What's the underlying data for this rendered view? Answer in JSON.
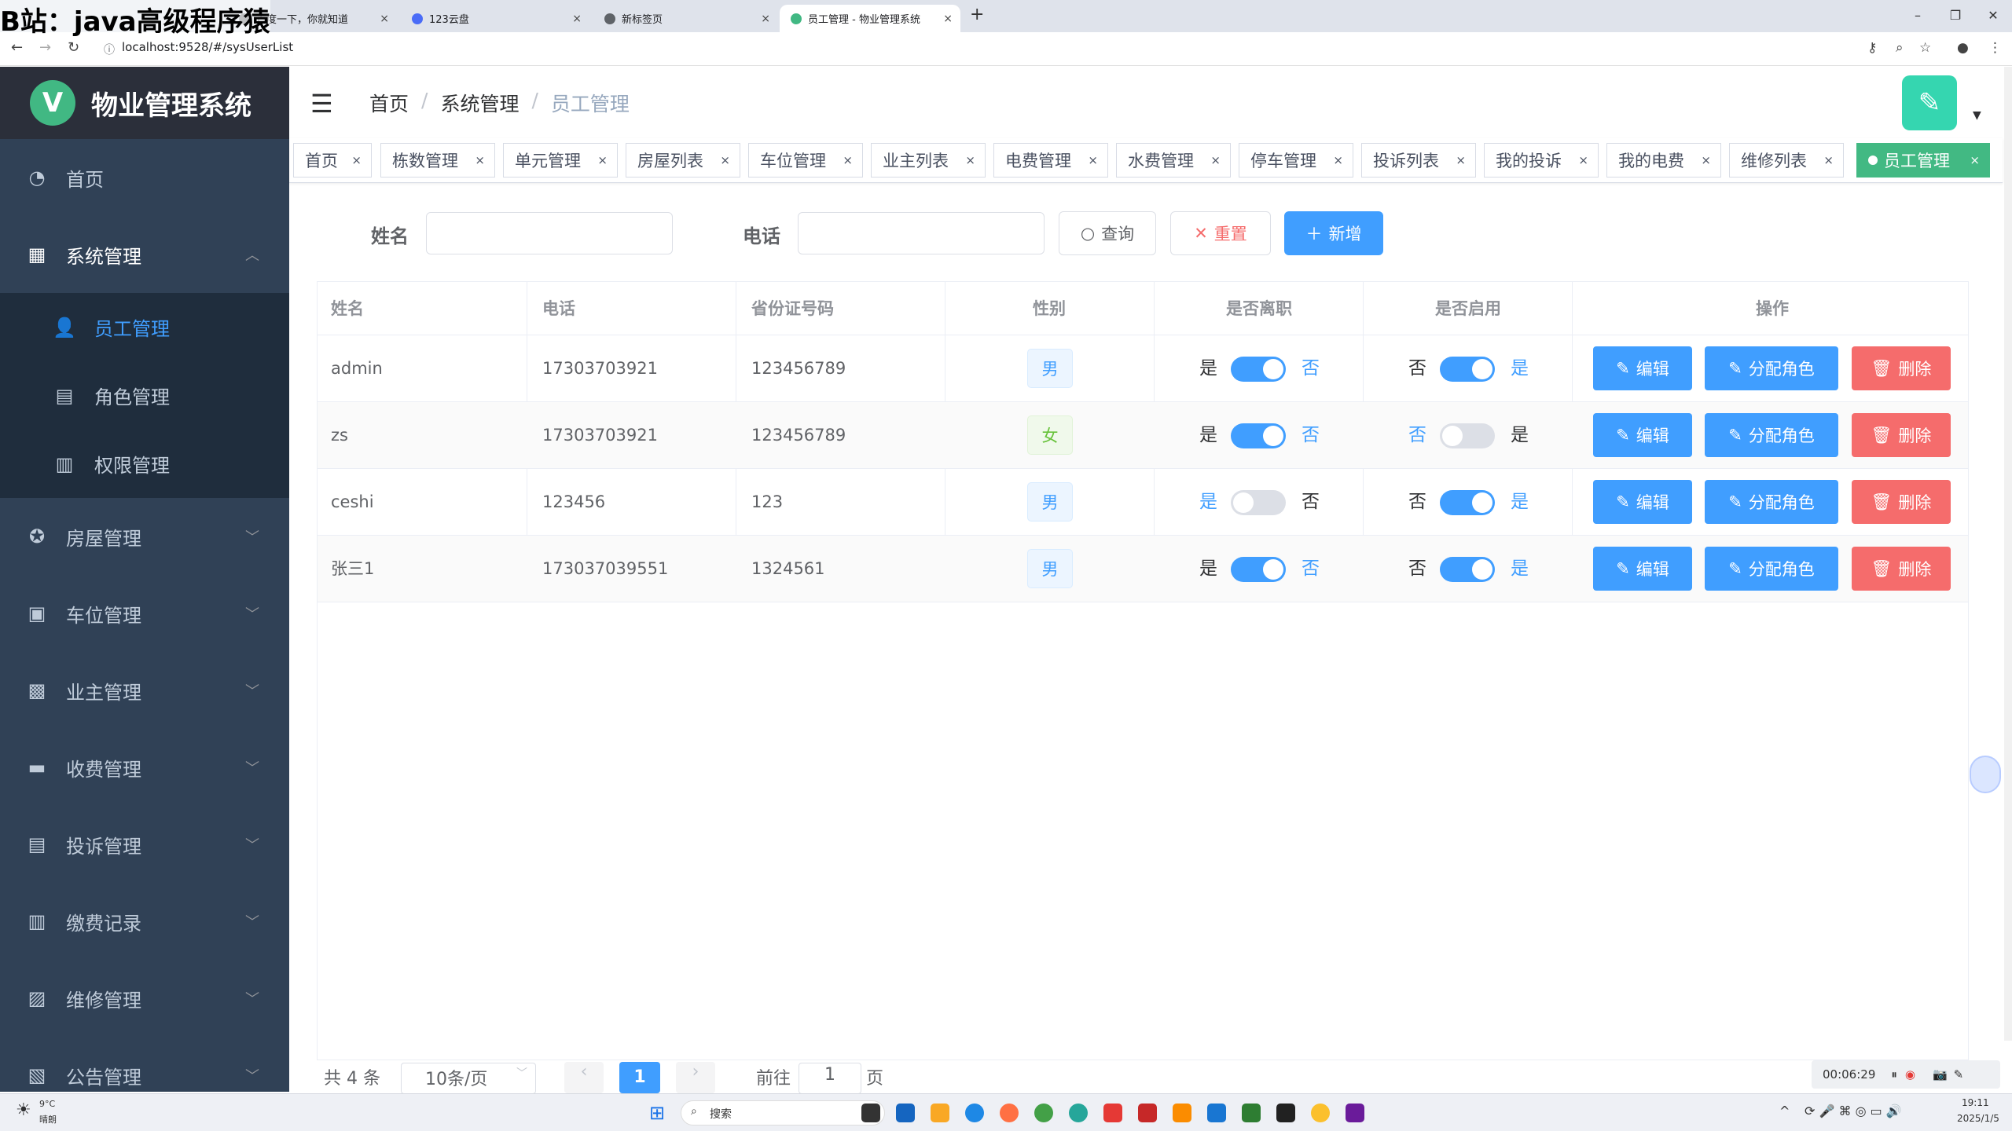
{
  "browser": {
    "tabs": [
      {
        "label": "百度一下，你就知道"
      },
      {
        "label": "123云盘"
      },
      {
        "label": "新标签页"
      },
      {
        "label": "员工管理 - 物业管理系统"
      }
    ],
    "url": "localhost:9528/#/sysUserList",
    "new_tab": "+"
  },
  "watermark": "B站：java高级程序猿",
  "sidebar": {
    "logo_letter": "V",
    "title": "物业管理系统",
    "items": [
      {
        "label": "首页",
        "icon": "dashboard-icon"
      },
      {
        "label": "系统管理",
        "icon": "grid-icon"
      },
      {
        "label": "房屋管理",
        "icon": "house-icon"
      },
      {
        "label": "车位管理",
        "icon": "parking-icon"
      },
      {
        "label": "业主管理",
        "icon": "apps-icon"
      },
      {
        "label": "收费管理",
        "icon": "fee-icon"
      },
      {
        "label": "投诉管理",
        "icon": "calendar-icon"
      },
      {
        "label": "缴费记录",
        "icon": "chart-icon"
      },
      {
        "label": "维修管理",
        "icon": "image-icon"
      },
      {
        "label": "公告管理",
        "icon": "notice-icon"
      }
    ],
    "sub_items": [
      {
        "label": "员工管理"
      },
      {
        "label": "角色管理"
      },
      {
        "label": "权限管理"
      }
    ]
  },
  "navbar": {
    "breadcrumb": [
      "首页",
      "系统管理",
      "员工管理"
    ]
  },
  "tags": [
    "首页",
    "栋数管理",
    "单元管理",
    "房屋列表",
    "车位管理",
    "业主列表",
    "电费管理",
    "水费管理",
    "停车管理",
    "投诉列表",
    "我的投诉",
    "我的电费",
    "维修列表",
    "员工管理"
  ],
  "search": {
    "name_label": "姓名",
    "phone_label": "电话",
    "query_btn": "查询",
    "reset_btn": "重置",
    "add_btn": "新增"
  },
  "table": {
    "headers": [
      "姓名",
      "电话",
      "省份证号码",
      "性别",
      "是否离职",
      "是否启用",
      "操作"
    ],
    "rows": [
      {
        "name": "admin",
        "phone": "17303703921",
        "idcard": "123456789",
        "gender": "男",
        "resigned": false,
        "enabled": true
      },
      {
        "name": "zs",
        "phone": "17303703921",
        "idcard": "123456789",
        "gender": "女",
        "resigned": false,
        "enabled": false
      },
      {
        "name": "ceshi",
        "phone": "123456",
        "idcard": "123",
        "gender": "男",
        "resigned": true,
        "enabled": true
      },
      {
        "name": "张三1",
        "phone": "173037039551",
        "idcard": "1324561",
        "gender": "男",
        "resigned": false,
        "enabled": true
      }
    ],
    "yes": "是",
    "no": "否",
    "edit_btn": "编辑",
    "assign_btn": "分配角色",
    "delete_btn": "删除"
  },
  "pagination": {
    "total": "共 4 条",
    "page_size": "10条/页",
    "current": "1",
    "goto_label": "前往",
    "goto_value": "1",
    "page_suffix": "页"
  },
  "recorder": {
    "time": "00:06:29"
  },
  "taskbar": {
    "weather_temp": "9°C",
    "weather_desc": "晴朗",
    "search": "搜索",
    "time": "19:11",
    "date": "2025/1/5"
  },
  "colors": {
    "primary": "#409eff",
    "danger": "#f56c6c",
    "success": "#42b983",
    "sidebar": "#304156"
  }
}
